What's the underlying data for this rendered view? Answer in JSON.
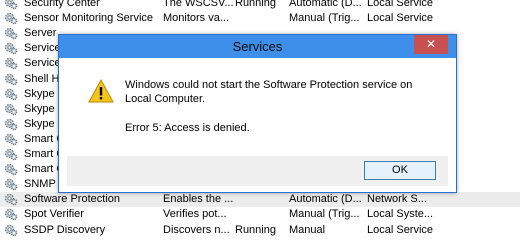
{
  "services": [
    {
      "name": "Security Center",
      "description": "The WSCSV...",
      "status": "Running",
      "startup": "Automatic (D...",
      "logon": "Local Service"
    },
    {
      "name": "Sensor Monitoring Service",
      "description": "Monitors va...",
      "status": "",
      "startup": "Manual (Trig...",
      "logon": "Local Service"
    },
    {
      "name": "Server",
      "description": "",
      "status": "",
      "startup": "",
      "logon": ""
    },
    {
      "name": "Service",
      "description": "",
      "status": "",
      "startup": "",
      "logon": ""
    },
    {
      "name": "Servicel",
      "description": "",
      "status": "",
      "startup": "",
      "logon": ""
    },
    {
      "name": "Shell H",
      "description": "",
      "status": "",
      "startup": "",
      "logon": ""
    },
    {
      "name": "Skype C",
      "description": "",
      "status": "",
      "startup": "",
      "logon": ""
    },
    {
      "name": "Skype C",
      "description": "",
      "status": "",
      "startup": "",
      "logon": ""
    },
    {
      "name": "Skype U",
      "description": "",
      "status": "",
      "startup": "",
      "logon": ""
    },
    {
      "name": "Smart C",
      "description": "",
      "status": "",
      "startup": "",
      "logon": ""
    },
    {
      "name": "Smart C",
      "description": "",
      "status": "",
      "startup": "",
      "logon": ""
    },
    {
      "name": "Smart C",
      "description": "",
      "status": "",
      "startup": "",
      "logon": ""
    },
    {
      "name": "SNMP T",
      "description": "",
      "status": "",
      "startup": "",
      "logon": ""
    },
    {
      "name": "Software Protection",
      "description": "Enables the ...",
      "status": "",
      "startup": "Automatic (D...",
      "logon": "Network S..."
    },
    {
      "name": "Spot Verifier",
      "description": "Verifies pot...",
      "status": "",
      "startup": "Manual (Trig...",
      "logon": "Local Syste..."
    },
    {
      "name": "SSDP Discovery",
      "description": "Discovers n...",
      "status": "Running",
      "startup": "Manual",
      "logon": "Local Service"
    }
  ],
  "selected_index": 13,
  "dialog": {
    "title": "Services",
    "close_label": "✕",
    "message": "Windows could not start the Software Protection service on Local Computer.",
    "error": "Error 5: Access is denied.",
    "ok_label": "OK",
    "icon": "warning-icon"
  },
  "colors": {
    "title_bar": "#3e8fe9",
    "close_button": "#c75050",
    "warning": "#f3c619"
  }
}
